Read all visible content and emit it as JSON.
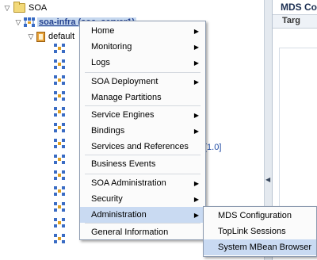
{
  "tree": {
    "root_label": "SOA",
    "soa_infra_label": "soa-infra (soa_server1)",
    "default_label": "default",
    "version_text": "[1.0]"
  },
  "right_panel": {
    "title": "MDS Co",
    "tab_label": "Targ"
  },
  "context_menu": {
    "items": [
      {
        "label": "Home",
        "submenu": true
      },
      {
        "label": "Monitoring",
        "submenu": true
      },
      {
        "label": "Logs",
        "submenu": true
      },
      {
        "label": "SOA Deployment",
        "submenu": true
      },
      {
        "label": "Manage Partitions",
        "submenu": false
      },
      {
        "label": "Service Engines",
        "submenu": true
      },
      {
        "label": "Bindings",
        "submenu": true
      },
      {
        "label": "Services and References",
        "submenu": false
      },
      {
        "label": "Business Events",
        "submenu": false
      },
      {
        "label": "SOA Administration",
        "submenu": true
      },
      {
        "label": "Security",
        "submenu": true
      },
      {
        "label": "Administration",
        "submenu": true
      },
      {
        "label": "General Information",
        "submenu": false
      }
    ],
    "active_item": "Administration",
    "arrow_glyph": "▶"
  },
  "submenu": {
    "items": [
      {
        "label": "MDS Configuration"
      },
      {
        "label": "TopLink Sessions"
      },
      {
        "label": "System MBean Browser"
      }
    ],
    "active_item": "System MBean Browser"
  },
  "colors": {
    "menu_highlight": "#c9daf2",
    "selection_text": "#23418f",
    "link_blue": "#1f4aa3"
  }
}
